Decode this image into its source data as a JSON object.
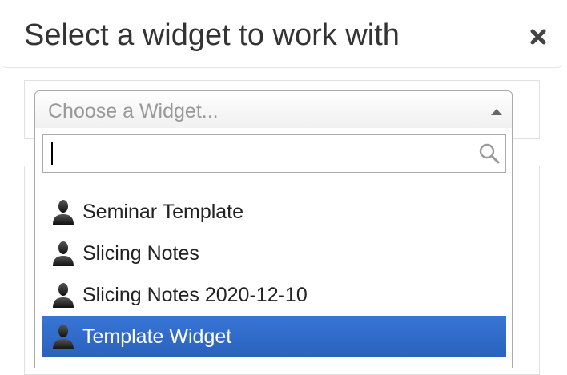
{
  "modal": {
    "title": "Select a widget to work with",
    "close_icon": "close-x-icon"
  },
  "selector": {
    "placeholder": "Choose a Widget...",
    "arrow_icon": "caret-up-icon",
    "search": {
      "value": "",
      "icon": "search-icon"
    },
    "results": [
      {
        "label": "Seminar Template",
        "icon": "user-icon",
        "highlighted": false
      },
      {
        "label": "Slicing Notes",
        "icon": "user-icon",
        "highlighted": false
      },
      {
        "label": "Slicing Notes 2020-12-10",
        "icon": "user-icon",
        "highlighted": false
      },
      {
        "label": "Template Widget",
        "icon": "user-icon",
        "highlighted": true
      }
    ]
  },
  "colors": {
    "highlight_top": "#3875d7",
    "highlight_bottom": "#2a62bc",
    "placeholder_text": "#999999",
    "border": "#aaaaaa"
  }
}
